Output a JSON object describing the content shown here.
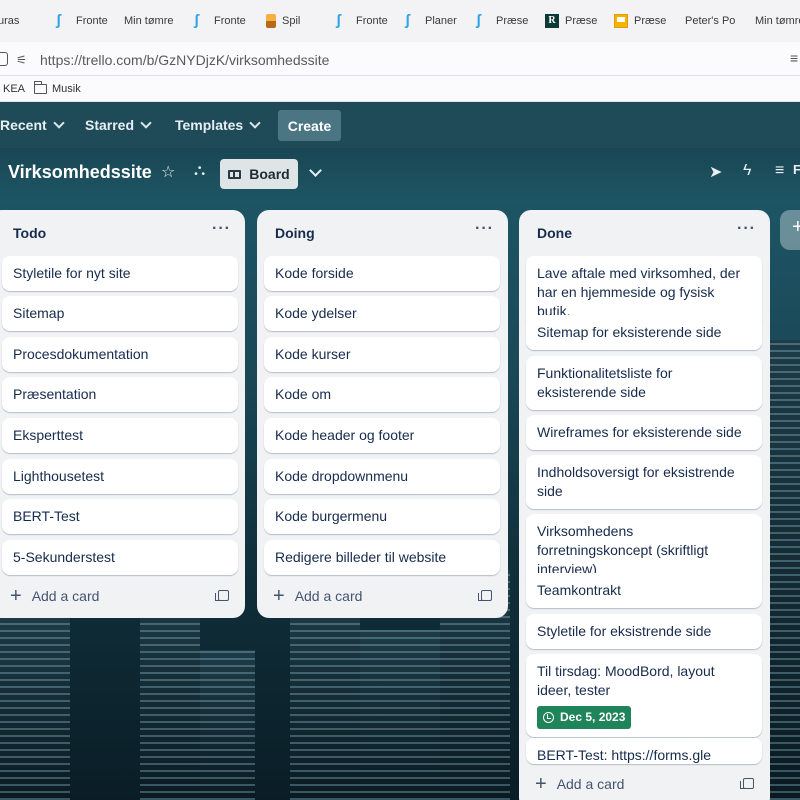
{
  "browser": {
    "tabs": [
      {
        "label": "uras",
        "icon": "none"
      },
      {
        "label": "Fronte",
        "icon": "frontend-icon"
      },
      {
        "label": "Min tømre",
        "icon": "none"
      },
      {
        "label": "Fronte",
        "icon": "frontend-icon"
      },
      {
        "label": "Spil",
        "icon": "spil-icon"
      },
      {
        "label": "Fronte",
        "icon": "frontend-icon"
      },
      {
        "label": "Planer",
        "icon": "frontend-icon"
      },
      {
        "label": "Præse",
        "icon": "frontend-icon"
      },
      {
        "label": "Præse",
        "icon": "r-icon"
      },
      {
        "label": "Præse",
        "icon": "slides-icon"
      },
      {
        "label": "Peter's Po",
        "icon": "none"
      },
      {
        "label": "Min tømre",
        "icon": "none"
      }
    ],
    "url": "https://trello.com/b/GzNYDjzK/virksomhedssite",
    "bookmarks": [
      {
        "label": "KEA",
        "icon": "none"
      },
      {
        "label": "Musik",
        "icon": "folder-icon"
      }
    ]
  },
  "trello_nav": {
    "recent": "Recent",
    "starred": "Starred",
    "templates": "Templates",
    "create": "Create"
  },
  "board": {
    "title": "Virksomhedssite",
    "view_button": "Board",
    "filter_label": "F"
  },
  "lists": [
    {
      "title": "Todo",
      "cards": [
        "Styletile for nyt site",
        "Sitemap",
        "Procesdokumentation",
        "Præsentation",
        "Eksperttest",
        "Lighthousetest",
        "BERT-Test",
        "5-Sekunderstest"
      ],
      "add_card": "Add a card"
    },
    {
      "title": "Doing",
      "cards": [
        "Kode forside",
        "Kode ydelser",
        "Kode kurser",
        "Kode om",
        "Kode header og footer",
        "Kode dropdownmenu",
        "Kode burgermenu",
        "Redigere billeder til website"
      ],
      "add_card": "Add a card"
    },
    {
      "title": "Done",
      "cards": [
        "Lave aftale med virksomhed, der har en hjemmeside og fysisk butik.",
        "Sitemap for eksisterende side",
        "Funktionalitetsliste for eksisterende side",
        "Wireframes for eksisterende side",
        "Indholdsoversigt for eksistrende side",
        "Virksomhedens forretningskoncept (skriftligt interview)",
        "Teamkontrakt",
        "Styletile for eksistrende side",
        "Til tirsdag: MoodBord, layout ideer, tester",
        "BERT-Test: https://forms.gle"
      ],
      "due_date": "Dec 5, 2023",
      "add_card": "Add a card"
    }
  ],
  "colors": {
    "nav_bg": "#1f4a58",
    "list_bg": "#f1f2f4",
    "due_badge": "#1f845a"
  }
}
